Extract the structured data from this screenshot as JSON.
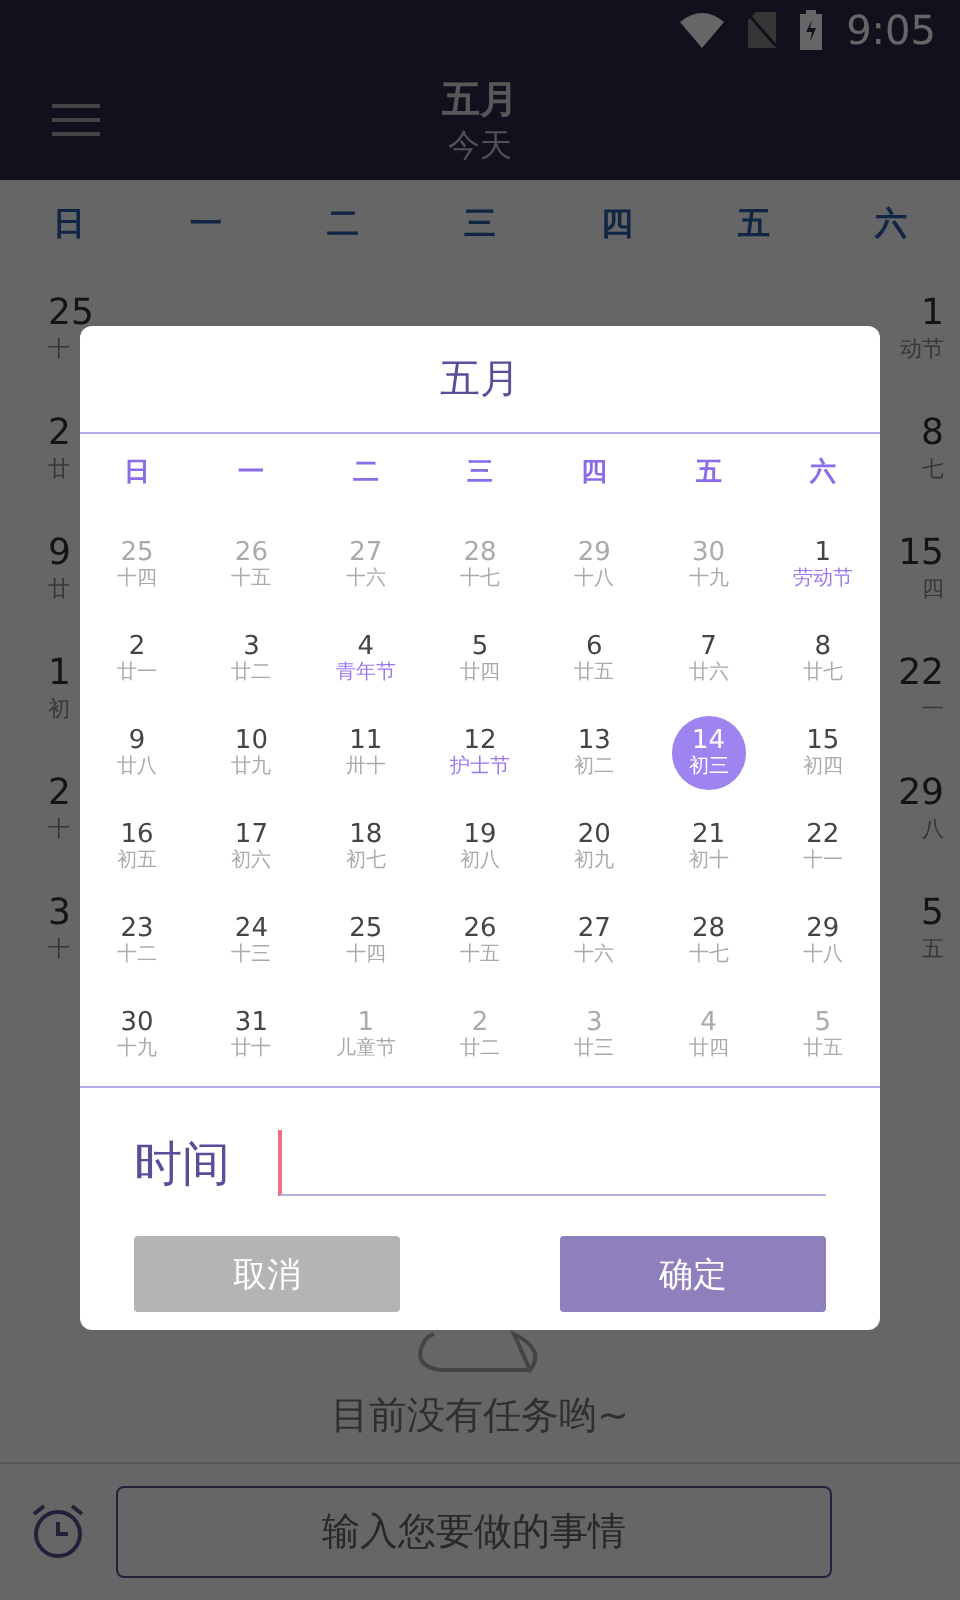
{
  "status_bar": {
    "time": "9:05"
  },
  "app_bar": {
    "title": "五月",
    "subtitle": "今天"
  },
  "weekdays": [
    "日",
    "一",
    "二",
    "三",
    "四",
    "五",
    "六"
  ],
  "background_rows": [
    {
      "left_day": "25",
      "left_lunar": "十",
      "right_day": "1",
      "right_lunar": "动节"
    },
    {
      "left_day": "2",
      "left_lunar": "廿",
      "right_day": "8",
      "right_lunar": "七"
    },
    {
      "left_day": "9",
      "left_lunar": "廿",
      "right_day": "15",
      "right_lunar": "四"
    },
    {
      "left_day": "1",
      "left_lunar": "初",
      "right_day": "22",
      "right_lunar": "一"
    },
    {
      "left_day": "2",
      "left_lunar": "十",
      "right_day": "29",
      "right_lunar": "八"
    },
    {
      "left_day": "3",
      "left_lunar": "十",
      "right_day": "5",
      "right_lunar": "五"
    }
  ],
  "empty_state": {
    "message": "目前没有任务哟~"
  },
  "task_input": {
    "placeholder": "输入您要做的事情"
  },
  "dialog": {
    "title": "五月",
    "weekdays": [
      "日",
      "一",
      "二",
      "三",
      "四",
      "五",
      "六"
    ],
    "weeks": [
      [
        {
          "day": "25",
          "lunar": "十四",
          "muted": true,
          "festival": false,
          "selected": false
        },
        {
          "day": "26",
          "lunar": "十五",
          "muted": true,
          "festival": false,
          "selected": false
        },
        {
          "day": "27",
          "lunar": "十六",
          "muted": true,
          "festival": false,
          "selected": false
        },
        {
          "day": "28",
          "lunar": "十七",
          "muted": true,
          "festival": false,
          "selected": false
        },
        {
          "day": "29",
          "lunar": "十八",
          "muted": true,
          "festival": false,
          "selected": false
        },
        {
          "day": "30",
          "lunar": "十九",
          "muted": true,
          "festival": false,
          "selected": false
        },
        {
          "day": "1",
          "lunar": "劳动节",
          "muted": false,
          "festival": true,
          "selected": false
        }
      ],
      [
        {
          "day": "2",
          "lunar": "廿一",
          "muted": false,
          "festival": false,
          "selected": false
        },
        {
          "day": "3",
          "lunar": "廿二",
          "muted": false,
          "festival": false,
          "selected": false
        },
        {
          "day": "4",
          "lunar": "青年节",
          "muted": false,
          "festival": true,
          "selected": false
        },
        {
          "day": "5",
          "lunar": "廿四",
          "muted": false,
          "festival": false,
          "selected": false
        },
        {
          "day": "6",
          "lunar": "廿五",
          "muted": false,
          "festival": false,
          "selected": false
        },
        {
          "day": "7",
          "lunar": "廿六",
          "muted": false,
          "festival": false,
          "selected": false
        },
        {
          "day": "8",
          "lunar": "廿七",
          "muted": false,
          "festival": false,
          "selected": false
        }
      ],
      [
        {
          "day": "9",
          "lunar": "廿八",
          "muted": false,
          "festival": false,
          "selected": false
        },
        {
          "day": "10",
          "lunar": "廿九",
          "muted": false,
          "festival": false,
          "selected": false
        },
        {
          "day": "11",
          "lunar": "卅十",
          "muted": false,
          "festival": false,
          "selected": false
        },
        {
          "day": "12",
          "lunar": "护士节",
          "muted": false,
          "festival": true,
          "selected": false
        },
        {
          "day": "13",
          "lunar": "初二",
          "muted": false,
          "festival": false,
          "selected": false
        },
        {
          "day": "14",
          "lunar": "初三",
          "muted": false,
          "festival": false,
          "selected": true
        },
        {
          "day": "15",
          "lunar": "初四",
          "muted": false,
          "festival": false,
          "selected": false
        }
      ],
      [
        {
          "day": "16",
          "lunar": "初五",
          "muted": false,
          "festival": false,
          "selected": false
        },
        {
          "day": "17",
          "lunar": "初六",
          "muted": false,
          "festival": false,
          "selected": false
        },
        {
          "day": "18",
          "lunar": "初七",
          "muted": false,
          "festival": false,
          "selected": false
        },
        {
          "day": "19",
          "lunar": "初八",
          "muted": false,
          "festival": false,
          "selected": false
        },
        {
          "day": "20",
          "lunar": "初九",
          "muted": false,
          "festival": false,
          "selected": false
        },
        {
          "day": "21",
          "lunar": "初十",
          "muted": false,
          "festival": false,
          "selected": false
        },
        {
          "day": "22",
          "lunar": "十一",
          "muted": false,
          "festival": false,
          "selected": false
        }
      ],
      [
        {
          "day": "23",
          "lunar": "十二",
          "muted": false,
          "festival": false,
          "selected": false
        },
        {
          "day": "24",
          "lunar": "十三",
          "muted": false,
          "festival": false,
          "selected": false
        },
        {
          "day": "25",
          "lunar": "十四",
          "muted": false,
          "festival": false,
          "selected": false
        },
        {
          "day": "26",
          "lunar": "十五",
          "muted": false,
          "festival": false,
          "selected": false
        },
        {
          "day": "27",
          "lunar": "十六",
          "muted": false,
          "festival": false,
          "selected": false
        },
        {
          "day": "28",
          "lunar": "十七",
          "muted": false,
          "festival": false,
          "selected": false
        },
        {
          "day": "29",
          "lunar": "十八",
          "muted": false,
          "festival": false,
          "selected": false
        }
      ],
      [
        {
          "day": "30",
          "lunar": "十九",
          "muted": false,
          "festival": false,
          "selected": false
        },
        {
          "day": "31",
          "lunar": "廿十",
          "muted": false,
          "festival": false,
          "selected": false
        },
        {
          "day": "1",
          "lunar": "儿童节",
          "muted": true,
          "festival": false,
          "selected": false
        },
        {
          "day": "2",
          "lunar": "廿二",
          "muted": true,
          "festival": false,
          "selected": false
        },
        {
          "day": "3",
          "lunar": "廿三",
          "muted": true,
          "festival": false,
          "selected": false
        },
        {
          "day": "4",
          "lunar": "廿四",
          "muted": true,
          "festival": false,
          "selected": false
        },
        {
          "day": "5",
          "lunar": "廿五",
          "muted": true,
          "festival": false,
          "selected": false
        }
      ]
    ],
    "time_label": "时间",
    "buttons": [
      {
        "kind": "cancel",
        "label": "取消"
      },
      {
        "kind": "confirm",
        "label": "确定"
      }
    ]
  }
}
